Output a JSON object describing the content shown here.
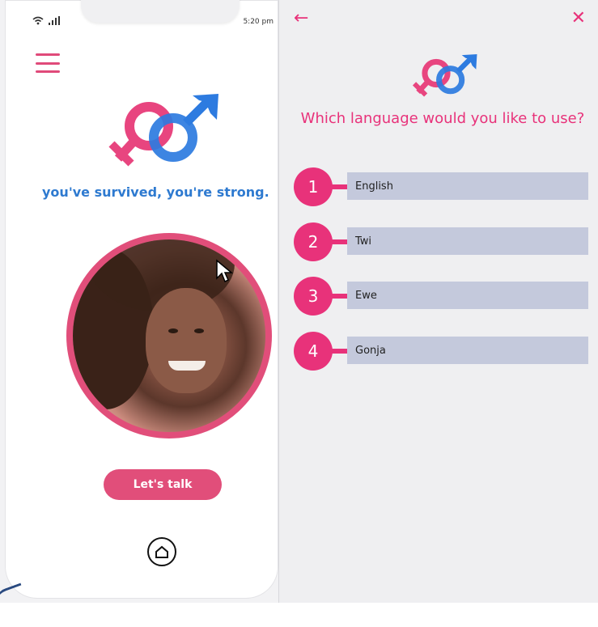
{
  "phone": {
    "status_time": "5:20 pm",
    "tagline": "you've survived, you're strong.",
    "cta_label": "Let's talk",
    "icons": {
      "wifi": "wifi-icon",
      "signal": "signal-icon",
      "menu": "hamburger-menu-icon",
      "logo": "gender-symbols-logo",
      "home": "home-icon",
      "cursor": "mouse-pointer-icon"
    }
  },
  "panel": {
    "back_icon": "←",
    "close_icon": "✕",
    "question": "Which language would you like to use?",
    "languages": [
      {
        "number": "1",
        "label": "English"
      },
      {
        "number": "2",
        "label": "Twi"
      },
      {
        "number": "3",
        "label": "Ewe"
      },
      {
        "number": "4",
        "label": "Gonja"
      }
    ]
  },
  "colors": {
    "accent_pink": "#e8327a",
    "button_pink": "#e14e7a",
    "tagline_blue": "#2e7ad0",
    "option_bar": "#c4c9dc",
    "panel_bg": "#efeff1"
  }
}
